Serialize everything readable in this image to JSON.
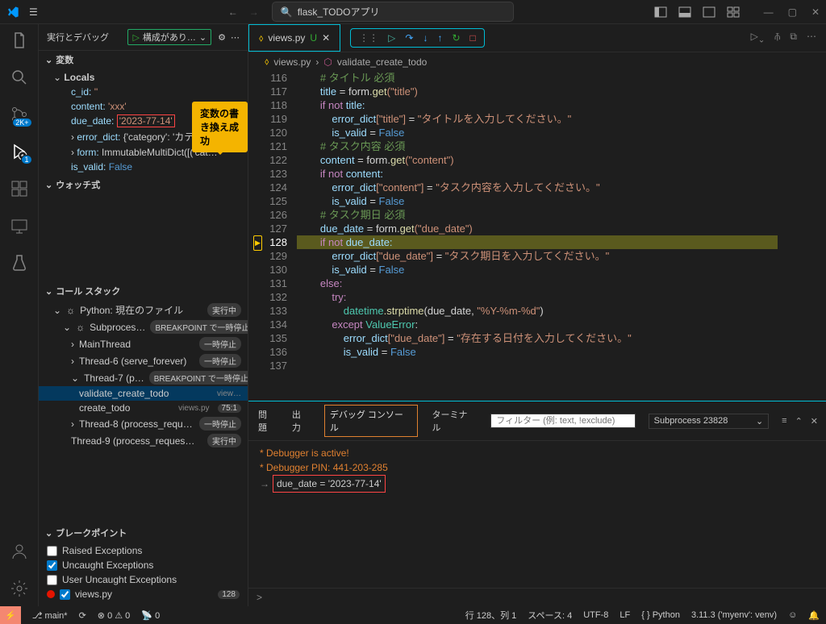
{
  "titlebar": {
    "search": "flask_TODOアプリ"
  },
  "sidebar": {
    "title": "実行とデバッグ",
    "config": "構成があり…",
    "sections": {
      "variables": "変数",
      "locals": "Locals",
      "watch": "ウォッチ式",
      "callstack": "コール スタック",
      "breakpoints": "ブレークポイント"
    },
    "vars": {
      "c_id": "c_id:",
      "c_id_val": "''",
      "content": "content:",
      "content_val": "'xxx'",
      "due_date": "due_date:",
      "due_date_val": "'2023-77-14'",
      "error_dict": "error_dict:",
      "error_dict_val": "{'category': 'カテ…",
      "form": "form:",
      "form_val": "ImmutableMultiDict([('cat…",
      "is_valid": "is_valid:",
      "is_valid_val": "False"
    },
    "tooltip": "変数の書き換え成功",
    "stack": {
      "python": "Python: 現在のファイル",
      "running": "実行中",
      "subprocess": "Subproces…",
      "bp_pause": "BREAKPOINT で一時停止",
      "main_thread": "MainThread",
      "paused": "一時停止",
      "thread6": "Thread-6 (serve_forever)",
      "thread7": "Thread-7 (p…",
      "frame1": "validate_create_todo",
      "frame1_file": "view…",
      "frame2": "create_todo",
      "frame2_file": "views.py",
      "frame2_pos": "75:1",
      "thread8": "Thread-8 (process_requ…",
      "thread9": "Thread-9 (process_reques…"
    },
    "bp": {
      "raised": "Raised Exceptions",
      "uncaught": "Uncaught Exceptions",
      "user_uncaught": "User Uncaught Exceptions",
      "file": "views.py",
      "count": "128"
    }
  },
  "editor": {
    "tab": "views.py",
    "tab_mod": "U",
    "breadcrumb_file": "views.py",
    "breadcrumb_func": "validate_create_todo",
    "lines": {
      "start": 116,
      "l116": "        # タイトル 必須",
      "l117_a": "title",
      "l117_b": " = form.",
      "l117_c": "get",
      "l117_d": "(\"title\")",
      "l118_a": "if not ",
      "l118_b": "title:",
      "l119_a": "error_dict",
      "l119_b": "[\"title\"]",
      "l119_c": " = ",
      "l119_d": "\"タイトルを入力してください。\"",
      "l120_a": "is_valid",
      "l120_b": " = ",
      "l120_c": "False",
      "l121": "        # タスク内容 必須",
      "l122_a": "content",
      "l122_b": " = form.",
      "l122_c": "get",
      "l122_d": "(\"content\")",
      "l123_a": "if not ",
      "l123_b": "content:",
      "l124_a": "error_dict",
      "l124_b": "[\"content\"]",
      "l124_c": " = ",
      "l124_d": "\"タスク内容を入力してください。\"",
      "l125_a": "is_valid",
      "l125_b": " = ",
      "l125_c": "False",
      "l126": "        # タスク期日 必須",
      "l127_a": "due_date",
      "l127_b": " = form.",
      "l127_c": "get",
      "l127_d": "(\"due_date\")",
      "l128_a": "if not ",
      "l128_b": "due_date:",
      "l129_a": "error_dict",
      "l129_b": "[\"due_date\"]",
      "l129_c": " = ",
      "l129_d": "\"タスク期日を入力してください。\"",
      "l130_a": "is_valid",
      "l130_b": " = ",
      "l130_c": "False",
      "l131": "else:",
      "l132": "try:",
      "l133_a": "datetime",
      "l133_b": ".strptime",
      "l133_c": "(due_date, ",
      "l133_d": "\"%Y-%m-%d\"",
      "l133_e": ")",
      "l134_a": "except ",
      "l134_b": "ValueError",
      "l134_c": ":",
      "l135_a": "error_dict",
      "l135_b": "[\"due_date\"]",
      "l135_c": " = ",
      "l135_d": "\"存在する日付を入力してください。\"",
      "l136_a": "is_valid",
      "l136_b": " = ",
      "l136_c": "False"
    }
  },
  "panel": {
    "tabs": {
      "problems": "問題",
      "output": "出力",
      "debug": "デバッグ コンソール",
      "terminal": "ターミナル"
    },
    "filter_ph": "フィルター (例: text, !exclude)",
    "process": "Subprocess 23828",
    "out1": " * Debugger is active!",
    "out2": " * Debugger PIN: 441-203-285",
    "expr": "due_date = '2023-77-14'",
    "prompt": ">"
  },
  "status": {
    "branch": "main*",
    "errs": "0",
    "warns": "0",
    "port": "0",
    "pos": "行 128、列 1",
    "spaces": "スペース: 4",
    "enc": "UTF-8",
    "eol": "LF",
    "lang": "Python",
    "interp": "3.11.3 ('myenv': venv)"
  }
}
